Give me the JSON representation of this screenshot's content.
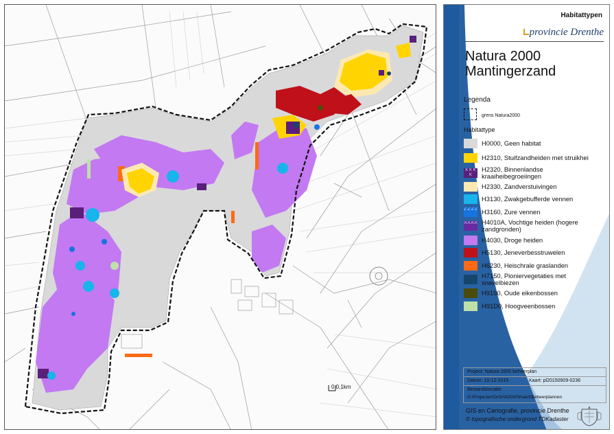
{
  "map": {
    "scale_label": "0   0,1km"
  },
  "sidebar": {
    "sheet_title": "Habitattypen",
    "logo_text": "provincie Drenthe",
    "area_title_line1": "Natura 2000",
    "area_title_line2": "Mantingerzand",
    "legend_heading": "Legenda",
    "boundary_label": "grens Natura2000",
    "habitat_heading": "Habitattype",
    "legend": [
      {
        "text": "H0000, Geen habitat",
        "color": "#d9d9d9",
        "pattern": ""
      },
      {
        "text": "H2310, Stuifzandheiden met struikhei",
        "color": "#ffd400",
        "pattern": ""
      },
      {
        "text": "H2320, Binnenlandse kraaiheibegroeiingen",
        "color": "#5a1f7a",
        "pattern": "K"
      },
      {
        "text": "H2330, Zandverstuivingen",
        "color": "#fde9b0",
        "pattern": ""
      },
      {
        "text": "H3130, Zwakgebufferde vennen",
        "color": "#18b4ec",
        "pattern": ""
      },
      {
        "text": "H3160, Zure vennen",
        "color": "#1673e0",
        "pattern": "Z"
      },
      {
        "text": "H4010A, Vochtige heiden (hogere zandgronden)",
        "color": "#6a2aa0",
        "pattern": "A"
      },
      {
        "text": "H4030, Droge heiden",
        "color": "#c279f2",
        "pattern": ""
      },
      {
        "text": "H5130, Jeneverbesstruwelen",
        "color": "#c0101a",
        "pattern": ""
      },
      {
        "text": "H6230, Heischrale graslanden",
        "color": "#ff6a14",
        "pattern": ""
      },
      {
        "text": "H7150, Pioniervegetaties met snavelbiezen",
        "color": "#16466e",
        "pattern": ""
      },
      {
        "text": "H9190, Oude eikenbossen",
        "color": "#4b4b0a",
        "pattern": ""
      },
      {
        "text": "H91D0, Hoogveenbossen",
        "color": "#bfe0a8",
        "pattern": ""
      }
    ],
    "project": "Project: Natura 2000 beheerplan",
    "date": "Datum: 10-12-2015",
    "map_id": "Kaart: pl20150909-0236",
    "file_label": "Bestandslocatie:",
    "file_path": "G:\\Projecten\\DrGr\\N2000\\Kaart\\Beheerplannen",
    "credit": "GIS en Cartografie, provincie Drenthe",
    "copyright": "© topografische ondergrond TDKadaster"
  }
}
